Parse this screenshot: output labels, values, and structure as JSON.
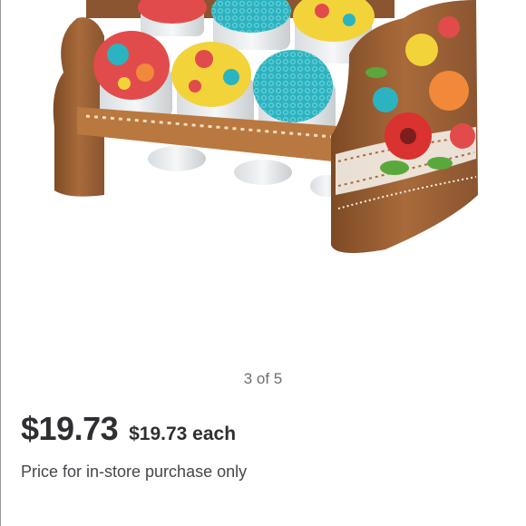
{
  "gallery": {
    "image_description_icon": "spice-rack-product-photo",
    "counter_text": "3 of 5"
  },
  "price": {
    "main": "$19.73",
    "unit": "$19.73 each",
    "note": "Price for in-store purchase only"
  },
  "colors": {
    "price_text": "#2e2f32",
    "counter_text": "#6d6e71",
    "wood": "#a86a3a",
    "teal_lid": "#2bb3c0",
    "yellow_lid": "#f2d33a"
  }
}
